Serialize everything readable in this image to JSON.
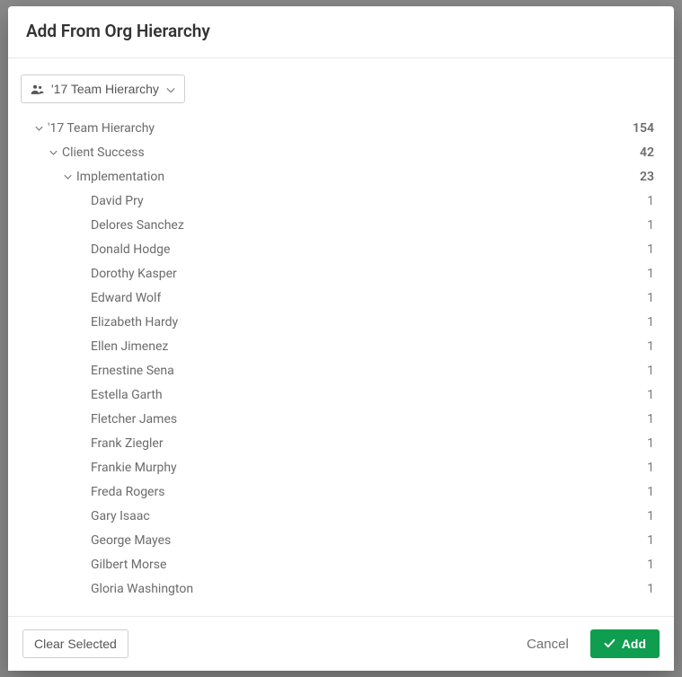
{
  "title": "Add From Org Hierarchy",
  "selector": {
    "label": "'17 Team Hierarchy"
  },
  "tree": [
    {
      "label": "'17 Team Hierarchy",
      "count": 154,
      "depth": 0,
      "expandable": true,
      "bold": true
    },
    {
      "label": "Client Success",
      "count": 42,
      "depth": 1,
      "expandable": true,
      "bold": true
    },
    {
      "label": "Implementation",
      "count": 23,
      "depth": 2,
      "expandable": true,
      "bold": true
    },
    {
      "label": "David Pry",
      "count": 1,
      "depth": 3,
      "expandable": false,
      "bold": false
    },
    {
      "label": "Delores Sanchez",
      "count": 1,
      "depth": 3,
      "expandable": false,
      "bold": false
    },
    {
      "label": "Donald Hodge",
      "count": 1,
      "depth": 3,
      "expandable": false,
      "bold": false
    },
    {
      "label": "Dorothy Kasper",
      "count": 1,
      "depth": 3,
      "expandable": false,
      "bold": false
    },
    {
      "label": "Edward Wolf",
      "count": 1,
      "depth": 3,
      "expandable": false,
      "bold": false
    },
    {
      "label": "Elizabeth Hardy",
      "count": 1,
      "depth": 3,
      "expandable": false,
      "bold": false
    },
    {
      "label": "Ellen Jimenez",
      "count": 1,
      "depth": 3,
      "expandable": false,
      "bold": false
    },
    {
      "label": "Ernestine Sena",
      "count": 1,
      "depth": 3,
      "expandable": false,
      "bold": false
    },
    {
      "label": "Estella Garth",
      "count": 1,
      "depth": 3,
      "expandable": false,
      "bold": false
    },
    {
      "label": "Fletcher James",
      "count": 1,
      "depth": 3,
      "expandable": false,
      "bold": false
    },
    {
      "label": "Frank Ziegler",
      "count": 1,
      "depth": 3,
      "expandable": false,
      "bold": false
    },
    {
      "label": "Frankie Murphy",
      "count": 1,
      "depth": 3,
      "expandable": false,
      "bold": false
    },
    {
      "label": "Freda Rogers",
      "count": 1,
      "depth": 3,
      "expandable": false,
      "bold": false
    },
    {
      "label": "Gary Isaac",
      "count": 1,
      "depth": 3,
      "expandable": false,
      "bold": false
    },
    {
      "label": "George Mayes",
      "count": 1,
      "depth": 3,
      "expandable": false,
      "bold": false
    },
    {
      "label": "Gilbert Morse",
      "count": 1,
      "depth": 3,
      "expandable": false,
      "bold": false
    },
    {
      "label": "Gloria Washington",
      "count": 1,
      "depth": 3,
      "expandable": false,
      "bold": false
    }
  ],
  "footer": {
    "clear": "Clear Selected",
    "cancel": "Cancel",
    "add": "Add"
  },
  "indentBase": 28,
  "indentStep": 16
}
